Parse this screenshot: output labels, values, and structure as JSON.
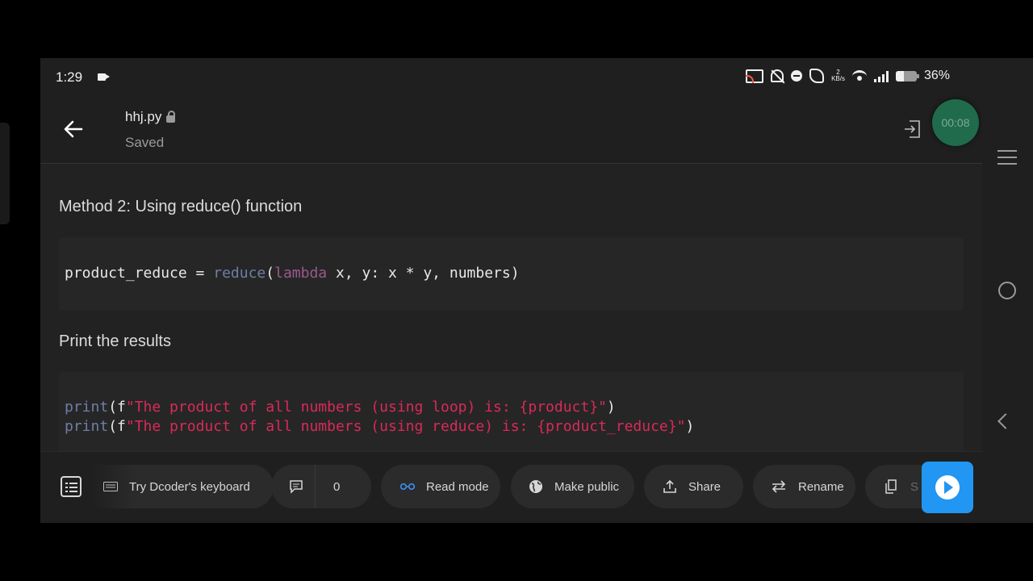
{
  "status_bar": {
    "time": "1:29",
    "net_speed_top": "2",
    "net_speed_unit": "KB/s",
    "battery": "36%"
  },
  "header": {
    "filename": "hhj.py",
    "save_state": "Saved",
    "timer": "00:08"
  },
  "content": {
    "heading1": "Method 2: Using reduce() function",
    "code1": {
      "var": "product_reduce",
      "eq": " = ",
      "fn": "reduce",
      "open": "(",
      "kw": "lambda",
      "rest": " x, y: x * y, numbers)"
    },
    "heading2": "Print the results",
    "code2": {
      "line1_fn": "print",
      "line1_open": "(f",
      "line1_str": "\"The product of all numbers (using loop) is: {product}\"",
      "line1_close": ")",
      "line2_fn": "print",
      "line2_open": "(f",
      "line2_str": "\"The product of all numbers (using reduce) is: {product_reduce}\"",
      "line2_close": ")"
    }
  },
  "toolbar": {
    "keyboard_label": "Try Dcoder's keyboard",
    "comments_count": "0",
    "read_mode_label": "Read mode",
    "make_public_label": "Make public",
    "share_label": "Share",
    "rename_label": "Rename",
    "partial_label": "S"
  },
  "colors": {
    "run_button": "#2196f3",
    "timer_bg": "#1f6b4c",
    "string": "#d92a58"
  }
}
